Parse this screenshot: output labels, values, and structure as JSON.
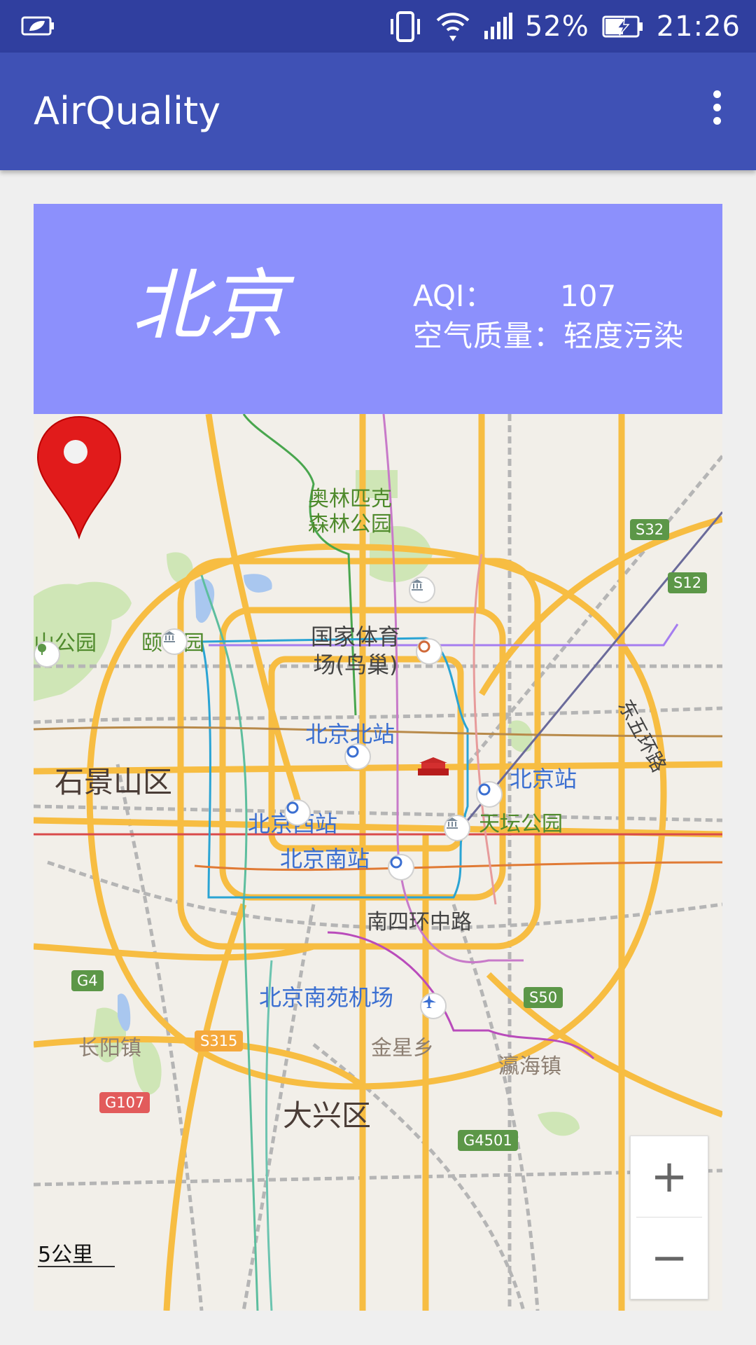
{
  "status_bar": {
    "battery_percent": "52%",
    "time": "21:26",
    "icons": [
      "leaf-battery-icon",
      "vibrate-icon",
      "wifi-icon",
      "signal-icon",
      "battery-icon"
    ]
  },
  "app_bar": {
    "title": "AirQuality",
    "menu_icon": "more-vert-icon"
  },
  "card": {
    "city": "北京",
    "aqi_label": "AQI：",
    "aqi_value": "107",
    "quality_label": "空气质量：",
    "quality_value": "轻度污染",
    "background": "#8c90fc"
  },
  "map": {
    "labels": {
      "olympic": "奥林匹克\n森林公园",
      "yiheyuan": "颐和园",
      "park_left": "山公园",
      "birdnest": "国家体育\n场(鸟巢)",
      "beijing_north": "北京北站",
      "shijingshan": "石景山区",
      "beijing_station": "北京站",
      "beijing_west": "北京西站",
      "tiantan": "天坛公园",
      "beijing_south": "北京南站",
      "nansihuan": "南四环中路",
      "dongwuhuan": "东五环路",
      "nanyuan": "北京南苑机场",
      "changyang": "长阳镇",
      "jinxing": "金星乡",
      "yinghai": "瀛海镇",
      "daxing": "大兴区"
    },
    "shields": {
      "s32": "S32",
      "s12": "S12",
      "g4": "G4",
      "s315": "S315",
      "s50": "S50",
      "g107": "G107",
      "g4501": "G4501"
    },
    "scale": "5公里",
    "zoom_in": "+",
    "zoom_out": "−",
    "marker_icon": "location-pin-icon"
  }
}
